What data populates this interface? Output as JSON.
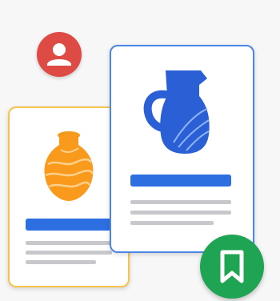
{
  "colors": {
    "blue": "#2d6fe0",
    "red": "#e8453c",
    "yellow": "#f6bf26",
    "green": "#1faa55",
    "avatar": "#de4b44",
    "green_badge": "#1ea453",
    "card_back_border": "#f6c34c",
    "card_front_border": "#4a86e8",
    "orange_vase": "#f99a1c",
    "blue_pitcher": "#2a5fd6"
  },
  "icons": {
    "avatar": "account-circle-icon",
    "bookmark": "bookmark-icon",
    "front_card_image": "pitcher-icon",
    "back_card_image": "vase-icon"
  }
}
